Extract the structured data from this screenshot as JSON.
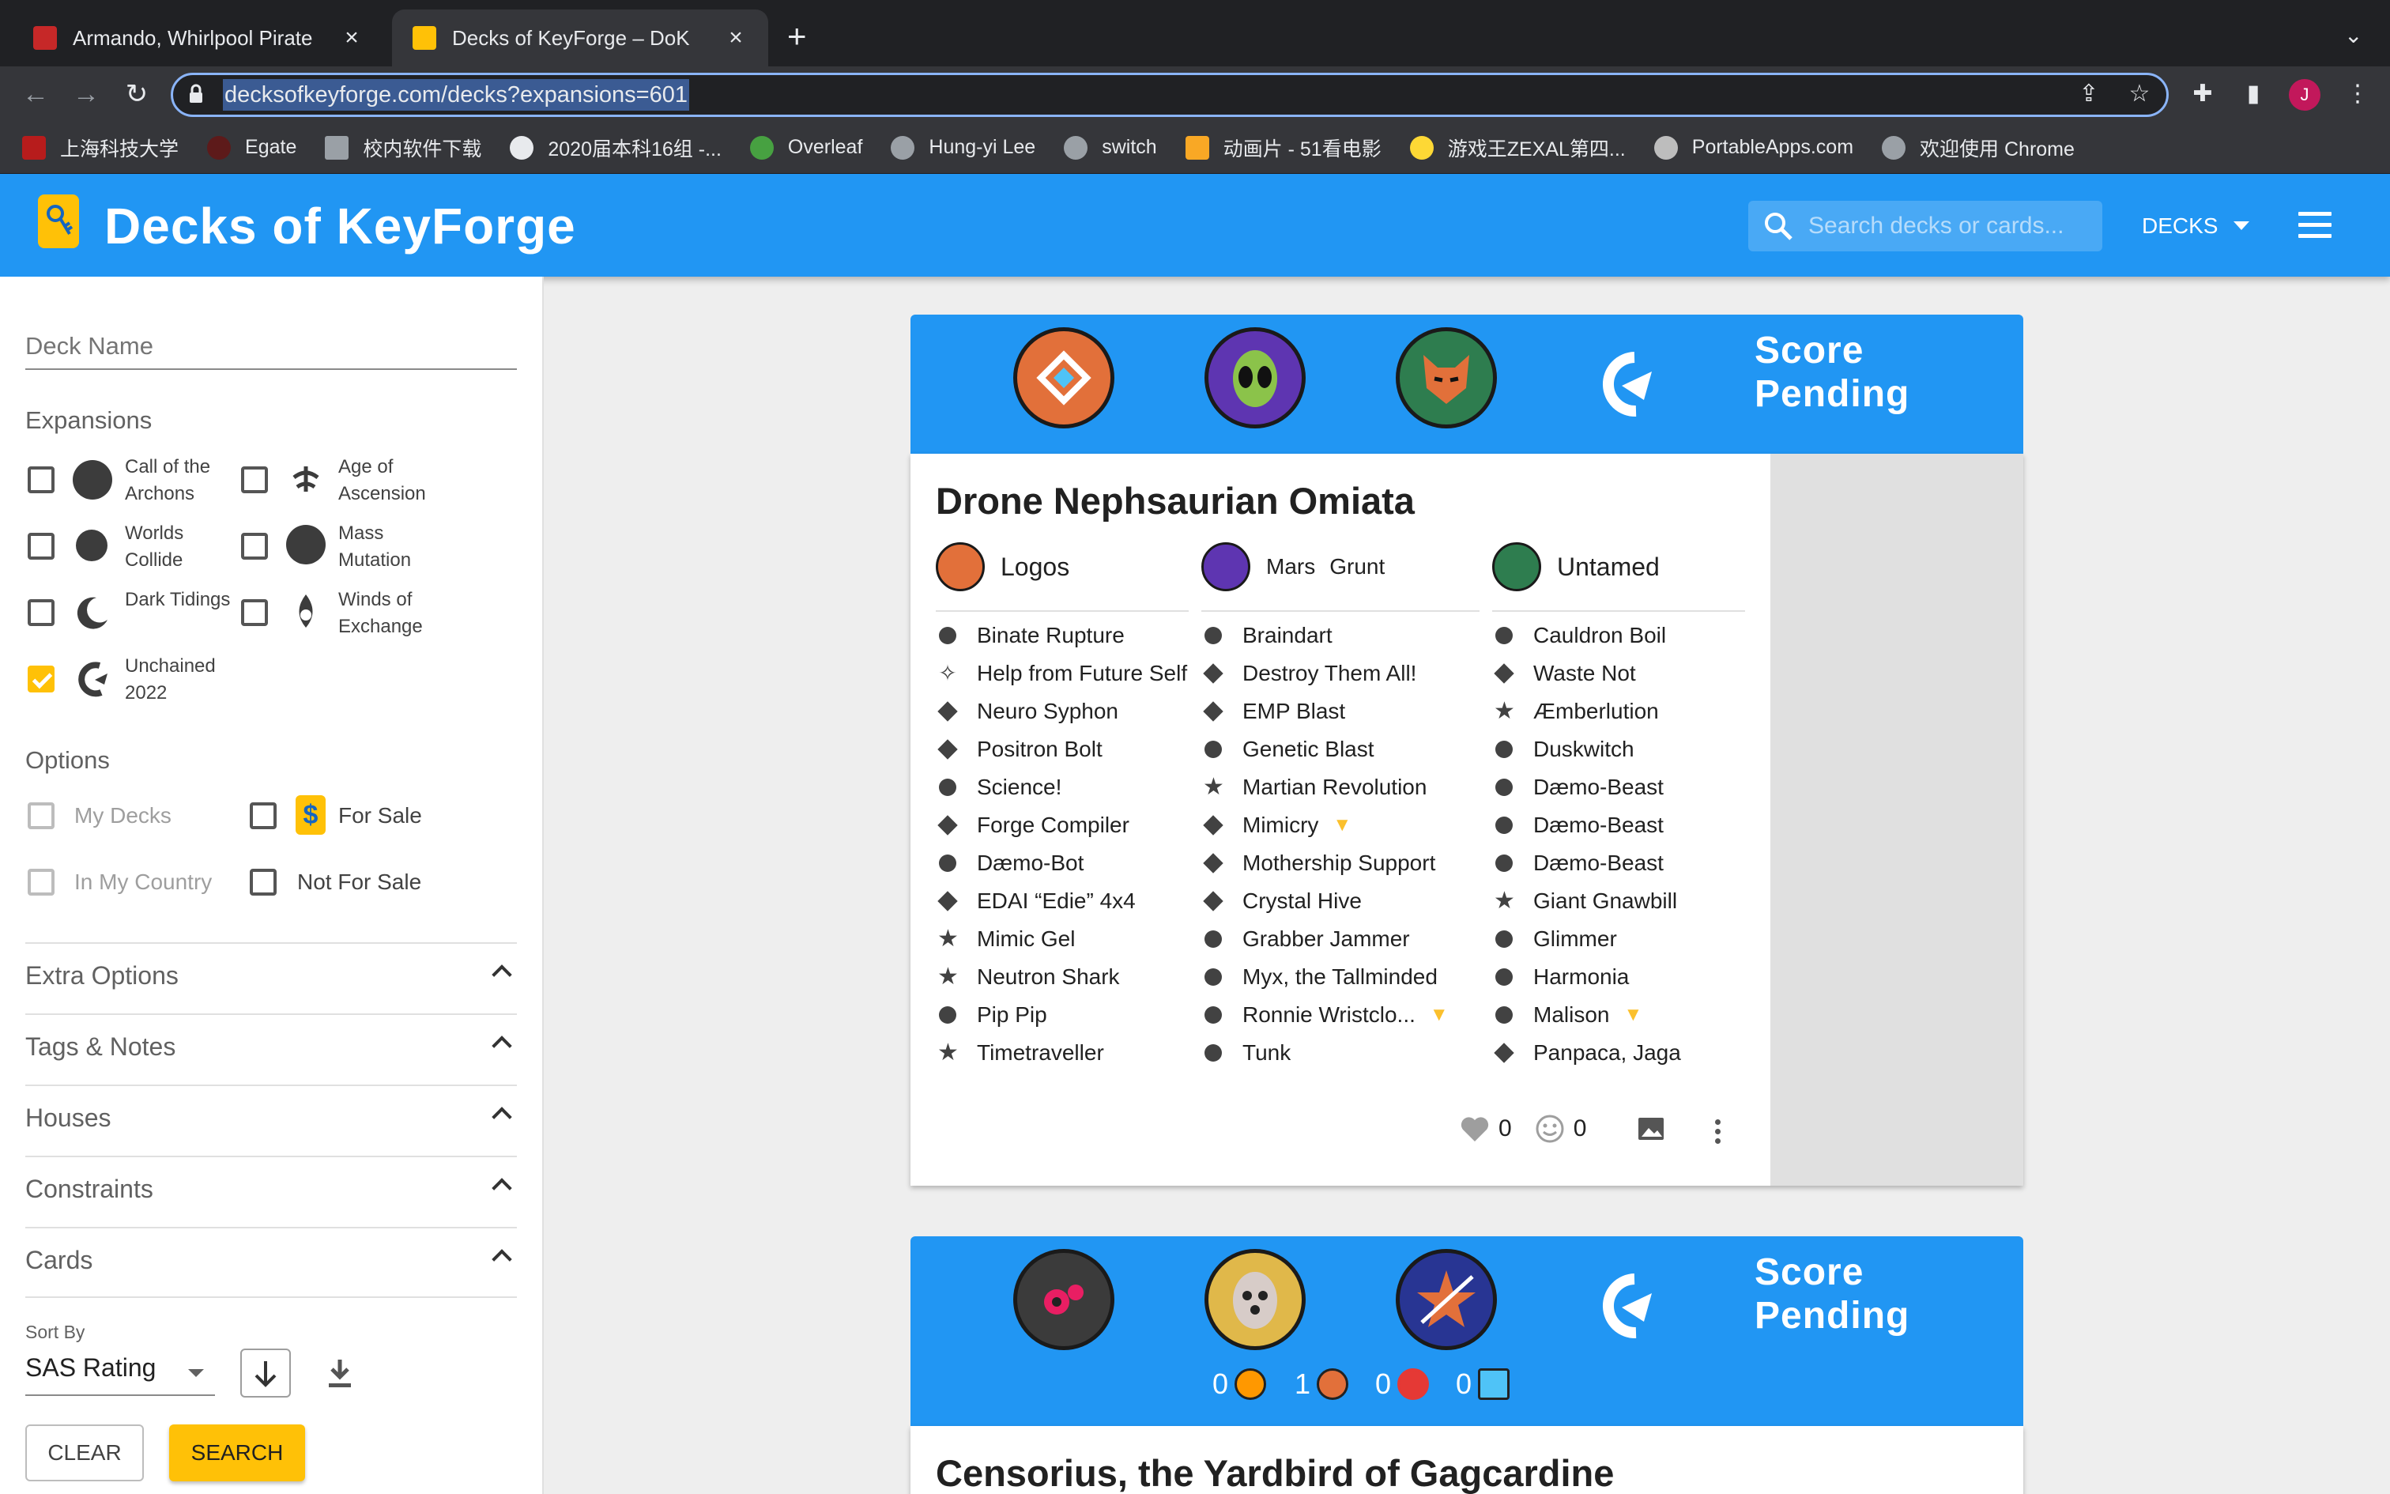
{
  "browser": {
    "tabs": [
      {
        "title": "Armando, Whirlpool Pirate",
        "active": false
      },
      {
        "title": "Decks of KeyForge – DoK",
        "active": true
      }
    ],
    "url": "decksofkeyforge.com/decks?expansions=601",
    "profile_initial": "J",
    "bookmarks": [
      {
        "label": "上海科技大学"
      },
      {
        "label": "Egate"
      },
      {
        "label": "校内软件下载"
      },
      {
        "label": "2020届本科16组 -..."
      },
      {
        "label": "Overleaf"
      },
      {
        "label": "Hung-yi Lee"
      },
      {
        "label": "switch"
      },
      {
        "label": "动画片 - 51看电影"
      },
      {
        "label": "游戏王ZEXAL第四..."
      },
      {
        "label": "PortableApps.com"
      },
      {
        "label": "欢迎使用 Chrome"
      }
    ]
  },
  "header": {
    "title": "Decks of KeyForge",
    "search_placeholder": "Search decks or cards...",
    "decks_menu": "DECKS",
    "brand_color": "#2196f3"
  },
  "sidebar": {
    "deck_name_placeholder": "Deck Name",
    "expansions_title": "Expansions",
    "expansions": [
      {
        "label": "Call of the Archons",
        "checked": false
      },
      {
        "label": "Age of Ascension",
        "checked": false
      },
      {
        "label": "Worlds Collide",
        "checked": false
      },
      {
        "label": "Mass Mutation",
        "checked": false
      },
      {
        "label": "Dark Tidings",
        "checked": false
      },
      {
        "label": "Winds of Exchange",
        "checked": false
      },
      {
        "label": "Unchained 2022",
        "checked": true
      }
    ],
    "options_title": "Options",
    "options": {
      "my_decks": "My Decks",
      "for_sale": "For Sale",
      "in_my_country": "In My Country",
      "not_for_sale": "Not For Sale"
    },
    "accordions": [
      "Extra Options",
      "Tags & Notes",
      "Houses",
      "Constraints",
      "Cards"
    ],
    "sort_by_label": "Sort By",
    "sort_by_value": "SAS Rating",
    "clear_label": "CLEAR",
    "search_label": "SEARCH"
  },
  "deck1": {
    "score": "Score Pending",
    "name": "Drone Nephsaurian Omiata",
    "houses": [
      {
        "name": "Logos",
        "cards": [
          {
            "name": "Binate Rupture",
            "rarity": "common"
          },
          {
            "name": "Help from Future Self",
            "rarity": "special"
          },
          {
            "name": "Neuro Syphon",
            "rarity": "uncommon"
          },
          {
            "name": "Positron Bolt",
            "rarity": "uncommon"
          },
          {
            "name": "Science!",
            "rarity": "common"
          },
          {
            "name": "Forge Compiler",
            "rarity": "uncommon"
          },
          {
            "name": "Dæmo-Bot",
            "rarity": "common"
          },
          {
            "name": "EDAI “Edie” 4x4",
            "rarity": "uncommon"
          },
          {
            "name": "Mimic Gel",
            "rarity": "rare"
          },
          {
            "name": "Neutron Shark",
            "rarity": "rare"
          },
          {
            "name": "Pip Pip",
            "rarity": "common"
          },
          {
            "name": "Timetraveller",
            "rarity": "rare"
          }
        ]
      },
      {
        "name": "Mars",
        "subtitle": "Grunt",
        "cards": [
          {
            "name": "Braindart",
            "rarity": "common"
          },
          {
            "name": "Destroy Them All!",
            "rarity": "uncommon"
          },
          {
            "name": "EMP Blast",
            "rarity": "uncommon"
          },
          {
            "name": "Genetic Blast",
            "rarity": "common"
          },
          {
            "name": "Martian Revolution",
            "rarity": "rare"
          },
          {
            "name": "Mimicry",
            "rarity": "uncommon",
            "enhanced": true
          },
          {
            "name": "Mothership Support",
            "rarity": "uncommon"
          },
          {
            "name": "Crystal Hive",
            "rarity": "uncommon"
          },
          {
            "name": "Grabber Jammer",
            "rarity": "common"
          },
          {
            "name": "Myx, the Tallminded",
            "rarity": "common"
          },
          {
            "name": "Ronnie Wristclo...",
            "rarity": "common",
            "enhanced": true
          },
          {
            "name": "Tunk",
            "rarity": "common"
          }
        ]
      },
      {
        "name": "Untamed",
        "cards": [
          {
            "name": "Cauldron Boil",
            "rarity": "common"
          },
          {
            "name": "Waste Not",
            "rarity": "uncommon"
          },
          {
            "name": "Æmberlution",
            "rarity": "rare"
          },
          {
            "name": "Duskwitch",
            "rarity": "common"
          },
          {
            "name": "Dæmo-Beast",
            "rarity": "common"
          },
          {
            "name": "Dæmo-Beast",
            "rarity": "common"
          },
          {
            "name": "Dæmo-Beast",
            "rarity": "common"
          },
          {
            "name": "Giant Gnawbill",
            "rarity": "rare"
          },
          {
            "name": "Glimmer",
            "rarity": "common"
          },
          {
            "name": "Harmonia",
            "rarity": "common"
          },
          {
            "name": "Malison",
            "rarity": "common",
            "enhanced": true
          },
          {
            "name": "Panpaca, Jaga",
            "rarity": "uncommon"
          }
        ]
      }
    ],
    "likes": "0",
    "funny": "0"
  },
  "deck2": {
    "score": "Score Pending",
    "name": "Censorius, the Yardbird of Gagcardine",
    "stats": [
      "0",
      "1",
      "0",
      "0"
    ]
  }
}
